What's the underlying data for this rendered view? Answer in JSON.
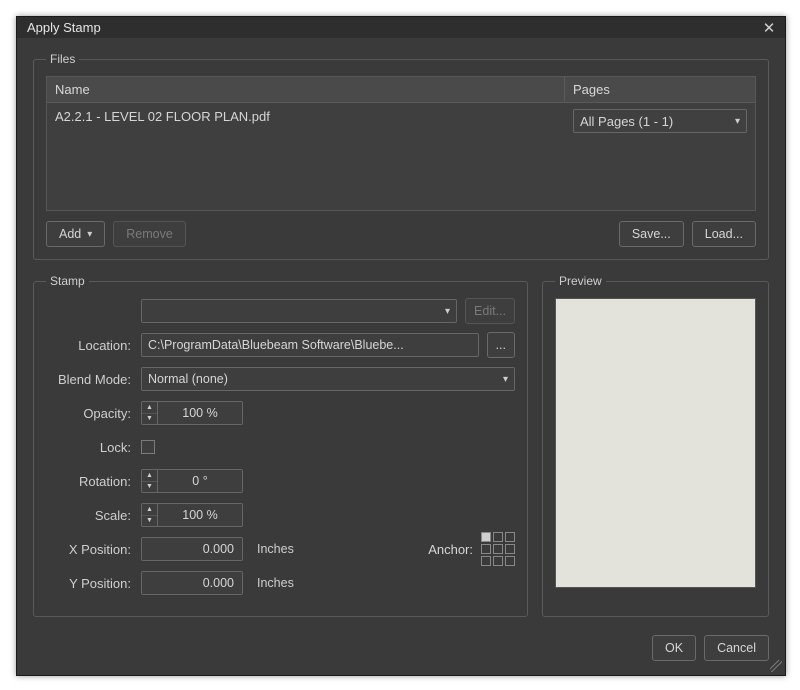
{
  "dialog": {
    "title": "Apply Stamp"
  },
  "files": {
    "legend": "Files",
    "columns": {
      "name": "Name",
      "pages": "Pages"
    },
    "rows": [
      {
        "name": "A2.2.1 - LEVEL 02 FLOOR PLAN.pdf",
        "pages": "All Pages (1 - 1)"
      }
    ],
    "buttons": {
      "add": "Add",
      "remove": "Remove",
      "save": "Save...",
      "load": "Load..."
    }
  },
  "stamp": {
    "legend": "Stamp",
    "selected": "",
    "edit": "Edit...",
    "labels": {
      "location": "Location:",
      "blend": "Blend Mode:",
      "opacity": "Opacity:",
      "lock": "Lock:",
      "rotation": "Rotation:",
      "scale": "Scale:",
      "xpos": "X Position:",
      "ypos": "Y Position:",
      "anchor": "Anchor:"
    },
    "location": "C:\\ProgramData\\Bluebeam Software\\Bluebe...",
    "browse": "...",
    "blend": "Normal (none)",
    "opacity": "100 %",
    "rotation": "0 °",
    "scale": "100 %",
    "xpos": "0.000",
    "ypos": "0.000",
    "unit": "Inches"
  },
  "preview": {
    "legend": "Preview"
  },
  "footer": {
    "ok": "OK",
    "cancel": "Cancel"
  }
}
